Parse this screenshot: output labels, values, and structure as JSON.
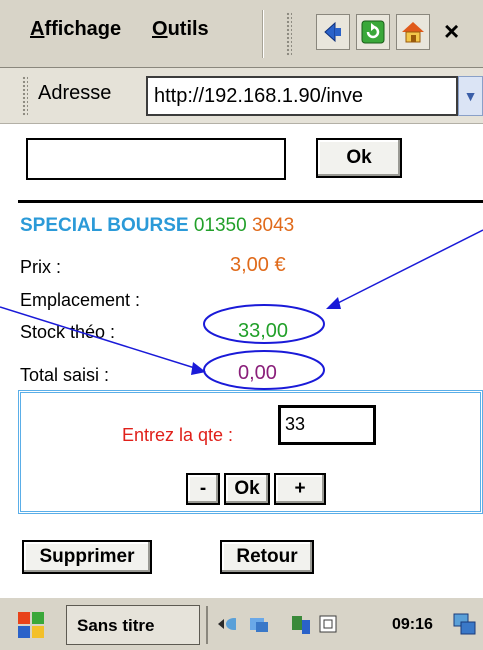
{
  "menubar": {
    "menus": [
      {
        "text": "Affichage",
        "key": "A",
        "rest": "ffichage"
      },
      {
        "text": "Outils",
        "key": "O",
        "rest": "utils"
      }
    ],
    "close_glyph": "×",
    "toolbar_icons": [
      "back-icon",
      "refresh-icon",
      "home-icon"
    ]
  },
  "address": {
    "label": "Adresse",
    "url": "http://192.168.1.90/inve",
    "dropdown_glyph": "▼"
  },
  "search": {
    "value": "",
    "ok_label": "Ok"
  },
  "product": {
    "name": "SPECIAL BOURSE",
    "code": "01350",
    "number": "3043"
  },
  "fields": {
    "prix_label": "Prix :",
    "prix_value": "3,00 €",
    "emplacement_label": "Emplacement :",
    "stock_label": "Stock théo :",
    "stock_value": "33,00",
    "total_label": "Total saisi :",
    "total_value": "0,00"
  },
  "qty": {
    "prompt": "Entrez la qte :",
    "value": "33",
    "minus": "-",
    "ok": "Ok",
    "plus": "+"
  },
  "actions": {
    "delete_label": "Supprimer",
    "back_label": "Retour"
  },
  "taskbar": {
    "window_title": "Sans titre",
    "clock": "09:16"
  },
  "colors": {
    "product_name": "#2b9ad8",
    "product_code": "#22a02a",
    "product_number": "#e06a1a",
    "prix": "#e06a1a",
    "stock": "#22a02a",
    "total": "#8a1f7a",
    "prompt": "#e0201a",
    "annotation": "#1a1ad8"
  }
}
